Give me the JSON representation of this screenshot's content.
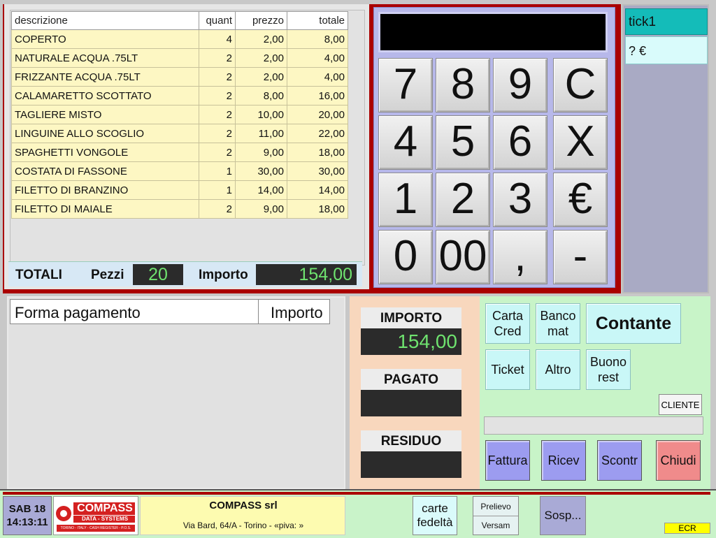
{
  "order": {
    "headers": [
      "descrizione",
      "quant",
      "prezzo",
      "totale"
    ],
    "rows": [
      [
        "COPERTO",
        "4",
        "2,00",
        "8,00"
      ],
      [
        "NATURALE ACQUA .75LT",
        "2",
        "2,00",
        "4,00"
      ],
      [
        "FRIZZANTE ACQUA .75LT",
        "2",
        "2,00",
        "4,00"
      ],
      [
        "CALAMARETTO SCOTTATO",
        "2",
        "8,00",
        "16,00"
      ],
      [
        "TAGLIERE MISTO",
        "2",
        "10,00",
        "20,00"
      ],
      [
        "LINGUINE ALLO SCOGLIO",
        "2",
        "11,00",
        "22,00"
      ],
      [
        "SPAGHETTI VONGOLE",
        "2",
        "9,00",
        "18,00"
      ],
      [
        "COSTATA DI FASSONE",
        "1",
        "30,00",
        "30,00"
      ],
      [
        "FILETTO DI BRANZINO",
        "1",
        "14,00",
        "14,00"
      ],
      [
        "FILETTO DI MAIALE",
        "2",
        "9,00",
        "18,00"
      ]
    ]
  },
  "totals": {
    "label": "TOTALI",
    "pezzi_label": "Pezzi",
    "pezzi": "20",
    "importo_label": "Importo",
    "importo": "154,00"
  },
  "keypad": {
    "keys": [
      "7",
      "8",
      "9",
      "C",
      "4",
      "5",
      "6",
      "X",
      "1",
      "2",
      "3",
      "€",
      "0",
      "00",
      ",",
      "-"
    ]
  },
  "ticket": {
    "name": "tick1",
    "amount": "? €"
  },
  "payment": {
    "col1": "Forma pagamento",
    "col2": "Importo"
  },
  "summary": {
    "importo_label": "IMPORTO",
    "importo": "154,00",
    "pagato_label": "PAGATO",
    "pagato": "",
    "residuo_label": "RESIDUO",
    "residuo": ""
  },
  "actions": {
    "carta_cred": "Carta Cred",
    "bancomat": "Banco mat",
    "contante": "Contante",
    "ticket": "Ticket",
    "altro": "Altro",
    "buono": "Buono rest",
    "cliente": "CLIENTE",
    "fattura": "Fattura",
    "ricev": "Ricev",
    "scontr": "Scontr",
    "chiudi": "Chiudi"
  },
  "status": {
    "day": "SAB 18",
    "time": "14:13:11",
    "logo_name": "COMPASS",
    "logo_sub": "DATA - SYSTEMS",
    "logo_tag": "TORINO - ITALY - CASH REGISTER - P.O.S.",
    "company": "COMPASS srl",
    "address": "Via Bard, 64/A - Torino -  «piva: »",
    "carte": "carte fedeltà",
    "prelievo": "Prelievo",
    "versam": "Versam",
    "sosp": "Sosp...",
    "ecr": "ECR"
  },
  "colors": {
    "accent_red": "#aa0000",
    "display_green": "#6fe36f",
    "ticket_teal": "#14bcb9"
  }
}
